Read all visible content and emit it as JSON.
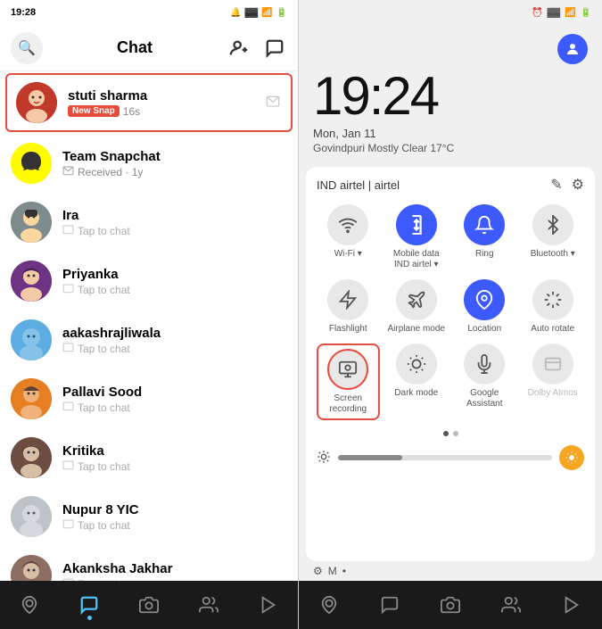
{
  "left_phone": {
    "status_bar": {
      "time": "19:28",
      "icons": "🔔 ⠿ 📶 🔋"
    },
    "header": {
      "title": "Chat",
      "add_friend_label": "+",
      "stories_label": "↩"
    },
    "chat_list": [
      {
        "id": "stuti",
        "name": "stuti sharma",
        "sub": "New Snap",
        "sub2": "16s",
        "type": "highlighted",
        "has_badge": true
      },
      {
        "id": "snapchat",
        "name": "Team Snapchat",
        "sub": "Received",
        "sub2": "1y",
        "type": "received"
      },
      {
        "id": "ira",
        "name": "Ira",
        "sub": "Tap to chat",
        "type": "tap"
      },
      {
        "id": "priyanka",
        "name": "Priyanka",
        "sub": "Tap to chat",
        "type": "tap"
      },
      {
        "id": "aakash",
        "name": "aakashrajliwala",
        "sub": "Tap to chat",
        "type": "tap"
      },
      {
        "id": "pallavi",
        "name": "Pallavi Sood",
        "sub": "Tap to chat",
        "type": "tap"
      },
      {
        "id": "kritika",
        "name": "Kritika",
        "sub": "Tap to chat",
        "type": "tap"
      },
      {
        "id": "nupur",
        "name": "Nupur 8 YIC",
        "sub": "Tap to chat",
        "type": "tap"
      },
      {
        "id": "akanksha",
        "name": "Akanksha Jakhar",
        "sub": "Tap to chat",
        "type": "tap"
      }
    ],
    "nav_items": [
      "📍",
      "💬",
      "📷",
      "👥",
      "▶"
    ]
  },
  "right_phone": {
    "status_bar": {
      "icons": "⏰ ⠿ 📶 🔋"
    },
    "time": "19:24",
    "date": "Mon, Jan 11",
    "weather": "Govindpuri Mostly Clear 17°C",
    "provider": "IND airtel | airtel",
    "quick_tiles": [
      {
        "id": "wifi",
        "icon": "📶",
        "label": "Wi-Fi ▾",
        "active": false
      },
      {
        "id": "mobile-data",
        "icon": "↕",
        "label": "Mobile data\nIND airtel ▾",
        "active": true
      },
      {
        "id": "ring",
        "icon": "🔔",
        "label": "Ring",
        "active": true
      },
      {
        "id": "bluetooth",
        "icon": "🔵",
        "label": "Bluetooth ▾",
        "active": false
      },
      {
        "id": "flashlight",
        "icon": "🔦",
        "label": "Flashlight",
        "active": false
      },
      {
        "id": "airplane",
        "icon": "✈",
        "label": "Airplane mode",
        "active": false
      },
      {
        "id": "location",
        "icon": "📍",
        "label": "Location",
        "active": true
      },
      {
        "id": "autorotate",
        "icon": "🔄",
        "label": "Auto rotate",
        "active": false
      },
      {
        "id": "screenrecord",
        "icon": "⏺",
        "label": "Screen\nrecording",
        "active": false,
        "highlighted": true
      },
      {
        "id": "darkmode",
        "icon": "☀",
        "label": "Dark mode",
        "active": false
      },
      {
        "id": "assistant",
        "icon": "🎤",
        "label": "Google\nAssistant",
        "active": false
      },
      {
        "id": "dolby",
        "icon": "◫",
        "label": "Dolby Atmos",
        "active": false
      }
    ],
    "brightness": 30,
    "nav_items": [
      "📍",
      "💬",
      "📷",
      "👥",
      "▶"
    ]
  }
}
